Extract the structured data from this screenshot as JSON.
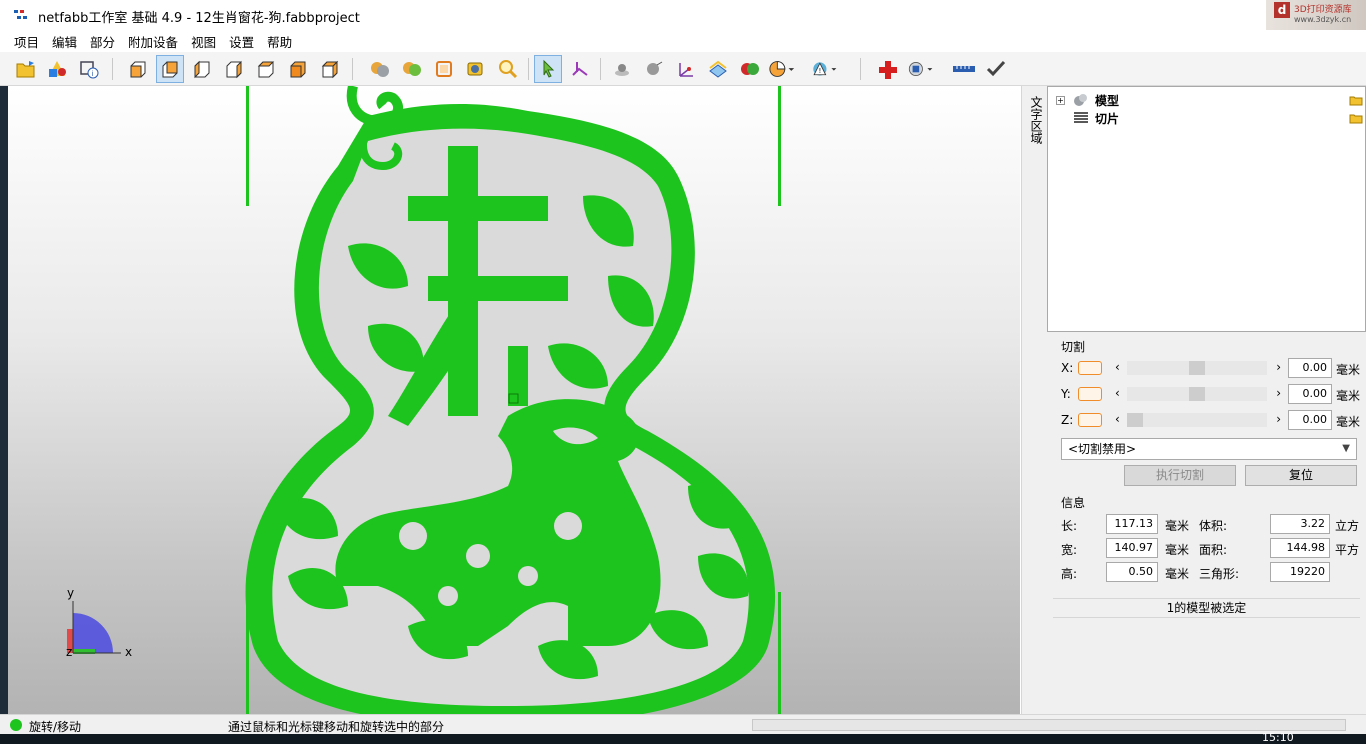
{
  "window": {
    "title": "netfabb工作室 基础 4.9 - 12生肖窗花-狗.fabbproject"
  },
  "watermark": {
    "logo_letter": "d",
    "text": "3D打印资源库",
    "url": "www.3dzyk.cn"
  },
  "menu": {
    "items": [
      "项目",
      "编辑",
      "部分",
      "附加设备",
      "视图",
      "设置",
      "帮助"
    ]
  },
  "toolbar": {
    "buttons": [
      "open-project-icon",
      "add-part-icon",
      "part-info-icon",
      "view-front-icon",
      "view-back-icon",
      "view-left-icon",
      "view-right-icon",
      "view-top-icon",
      "view-bottom-icon",
      "view-iso-icon",
      "shade-icon",
      "texture-icon",
      "wireframe-icon",
      "screenshot-icon",
      "zoom-icon",
      "select-cursor-icon",
      "move-rotate-icon",
      "measure-point-icon",
      "measure-sphere-icon",
      "axes-icon",
      "slice-icon",
      "boolean-icon",
      "pie-chart-icon",
      "warning-icon",
      "repair-cross-icon",
      "analyse-icon",
      "ruler-icon",
      "check-icon"
    ],
    "active_button": "view-back-icon"
  },
  "viewport": {
    "axes": {
      "x": "x",
      "y": "y",
      "z": "z"
    },
    "model_color": "#1ec41e"
  },
  "side_tab": {
    "label": "文字区域"
  },
  "tree": {
    "items": [
      {
        "label": "模型",
        "expandable": true
      },
      {
        "label": "切片",
        "expandable": false
      }
    ]
  },
  "cut": {
    "title": "切割",
    "axes": [
      {
        "label": "X:",
        "value": "0.00",
        "unit": "毫米",
        "thumb": 0.5
      },
      {
        "label": "Y:",
        "value": "0.00",
        "unit": "毫米",
        "thumb": 0.5
      },
      {
        "label": "Z:",
        "value": "0.00",
        "unit": "毫米",
        "thumb": 0.0
      }
    ],
    "mode": "<切割禁用>",
    "execute_label": "执行切割",
    "reset_label": "复位"
  },
  "info": {
    "title": "信息",
    "length_label": "长:",
    "length_value": "117.13",
    "length_unit": "毫米",
    "width_label": "宽:",
    "width_value": "140.97",
    "width_unit": "毫米",
    "height_label": "高:",
    "height_value": "0.50",
    "height_unit": "毫米",
    "volume_label": "体积:",
    "volume_value": "3.22",
    "volume_unit": "立方",
    "area_label": "面积:",
    "area_value": "144.98",
    "area_unit": "平方",
    "triangles_label": "三角形:",
    "triangles_value": "19220",
    "selection_status": "1的模型被选定"
  },
  "status": {
    "mode": "旋转/移动",
    "hint": "通过鼠标和光标键移动和旋转选中的部分"
  },
  "taskbar": {
    "clock": "15:10"
  }
}
